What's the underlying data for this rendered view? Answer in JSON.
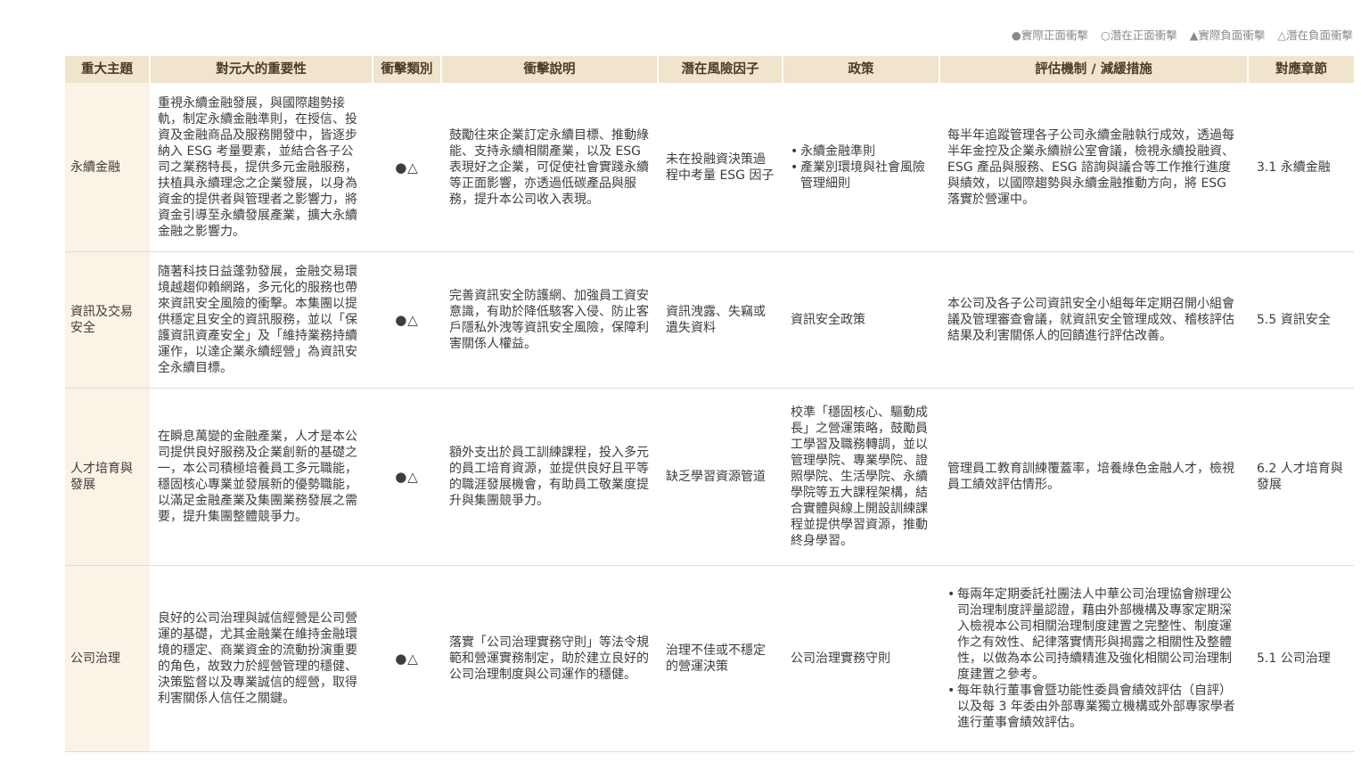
{
  "legend": {
    "actual_positive": "●實際正面衝擊",
    "potential_positive": "○潛在正面衝擊",
    "actual_negative": "▲實際負面衝擊",
    "potential_negative": "△潛在負面衝擊"
  },
  "headers": [
    "重大主題",
    "對元大的重要性",
    "衝擊類別",
    "衝擊說明",
    "潛在風險因子",
    "政策",
    "評估機制 / 減緩措施",
    "對應章節"
  ],
  "rows": [
    {
      "topic": "永續金融",
      "importance": "重視永續金融發展，與國際趨勢接軌，制定永續金融準則，在授信、投資及金融商品及服務開發中，皆逐步納入 ESG 考量要素，並結合各子公司之業務特長，提供多元金融服務，扶植具永續理念之企業發展，以身為資金的提供者與管理者之影響力，將資金引導至永續發展產業，擴大永續金融之影響力。",
      "impact_type": "●△",
      "impact_desc": "鼓勵往來企業訂定永續目標、推動綠能、支持永續相關產業，以及 ESG 表現好之企業，可促使社會實踐永續等正面影響，亦透過低碳產品與服務，提升本公司收入表現。",
      "risk": "未在投融資決策過程中考量 ESG 因子",
      "policy_items": [
        "永續金融準則",
        "產業別環境與社會風險管理細則"
      ],
      "measures": "每半年追蹤管理各子公司永續金融執行成效，透過每半年金控及企業永續辦公室會議，檢視永續投融資、ESG 產品與服務、ESG 諮詢與議合等工作推行進度與績效，以國際趨勢與永續金融推動方向，將 ESG 落實於營運中。",
      "chapter": "3.1 永續金融"
    },
    {
      "topic": "資訊及交易安全",
      "importance": "隨著科技日益蓬勃發展，金融交易環境越趨仰賴網路，多元化的服務也帶來資訊安全風險的衝擊。本集團以提供穩定且安全的資訊服務，並以「保護資訊資產安全」及「維持業務持續運作，以達企業永續經營」為資訊安全永續目標。",
      "impact_type": "●△",
      "impact_desc": "完善資訊安全防護網、加強員工資安意識，有助於降低駭客入侵、防止客戶隱私外洩等資訊安全風險，保障利害關係人權益。",
      "risk": "資訊洩露、失竊或遺失資料",
      "policy": "資訊安全政策",
      "measures": "本公司及各子公司資訊安全小組每年定期召開小組會議及管理審查會議，就資訊安全管理成效、稽核評估結果及利害關係人的回饋進行評估改善。",
      "chapter": "5.5 資訊安全"
    },
    {
      "topic": "人才培育與發展",
      "importance": "在瞬息萬變的金融產業，人才是本公司提供良好服務及企業創新的基礎之一，本公司積極培養員工多元職能，穩固核心專業並發展新的優勢職能，以滿足金融產業及集團業務發展之需要，提升集團整體競爭力。",
      "impact_type": "●△",
      "impact_desc": "額外支出於員工訓練課程，投入多元的員工培育資源，並提供良好且平等的職涯發展機會，有助員工敬業度提升與集團競爭力。",
      "risk": "缺乏學習資源管道",
      "policy": "校準「穩固核心、驅動成長」之營運策略，鼓勵員工學習及職務轉調，並以管理學院、專業學院、證照學院、生活學院、永續學院等五大課程架構，結合實體與線上開設訓練課程並提供學習資源，推動終身學習。",
      "measures": "管理員工教育訓練覆蓋率，培養綠色金融人才，檢視員工績效評估情形。",
      "chapter": "6.2 人才培育與發展"
    },
    {
      "topic": "公司治理",
      "importance": "良好的公司治理與誠信經營是公司營運的基礎，尤其金融業在維持金融環境的穩定、商業資金的流動扮演重要的角色，故致力於經營管理的穩健、決策監督以及專業誠信的經營，取得利害關係人信任之關鍵。",
      "impact_type": "●△",
      "impact_desc": "落實「公司治理實務守則」等法令規範和營運實務制定，助於建立良好的公司治理制度與公司運作的穩健。",
      "risk": "治理不佳或不穩定的營運決策",
      "policy": "公司治理實務守則",
      "measure_items": [
        "每兩年定期委託社團法人中華公司治理協會辦理公司治理制度評量認證，藉由外部機構及專家定期深入檢視本公司相關治理制度建置之完整性、制度運作之有效性、紀律落實情形與揭露之相關性及整體性，以做為本公司持續精進及強化相關公司治理制度建置之參考。",
        "每年執行董事會暨功能性委員會績效評估（自評）以及每 3 年委由外部專業獨立機構或外部專家學者進行董事會績效評估。"
      ],
      "chapter": "5.1 公司治理"
    }
  ]
}
